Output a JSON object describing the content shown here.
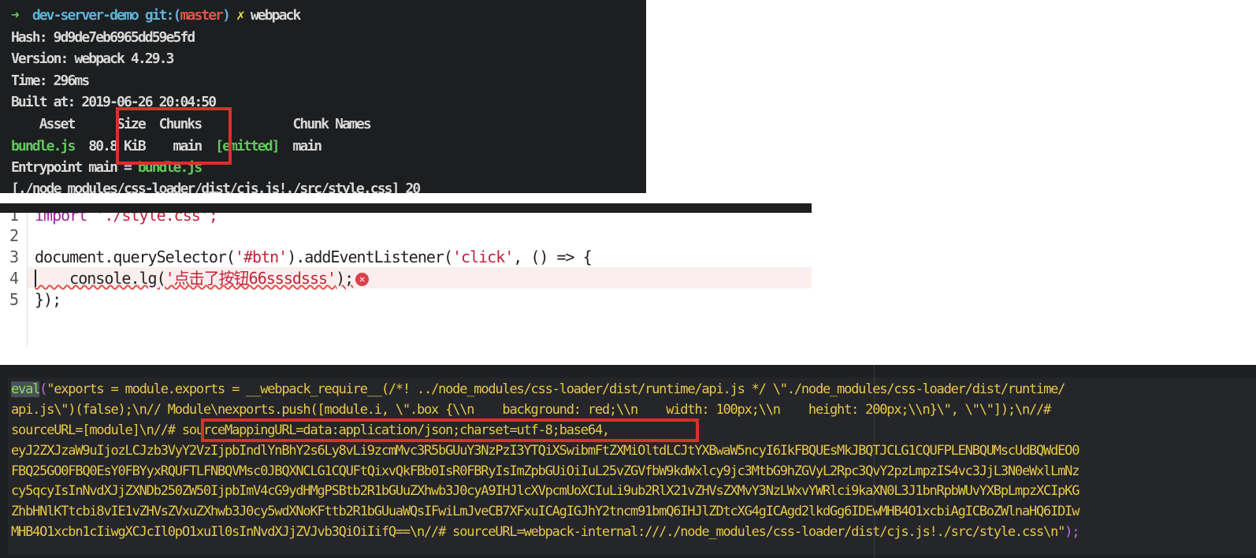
{
  "terminal": {
    "prompt_arrow": "➜",
    "dir": "dev-server-demo",
    "git_label": "git:(",
    "branch": "master",
    "git_close": ")",
    "dirty_mark": "✗",
    "command": "webpack",
    "hash": "Hash: 9d9de7eb6965dd59e5fd",
    "version": "Version: webpack 4.29.3",
    "time": "Time: 296ms",
    "built_at": "Built at: 2019-06-26 20:04:50",
    "table_header": "    Asset      Size  Chunks             Chunk Names",
    "asset_name": "bundle.js",
    "asset_size": "  80.8 KiB",
    "asset_chunks": "    main  ",
    "asset_status": "[emitted]",
    "asset_chunk_name": "  main",
    "entrypoint_label": "Entrypoint main = ",
    "entrypoint_file": "bundle.js",
    "module_line": "[./node_modules/css-loader/dist/cjs.js!./src/style.css] 20"
  },
  "editor": {
    "lines": [
      {
        "num": "1",
        "kw": "import",
        "rest": " './style.css';"
      },
      {
        "num": "2"
      },
      {
        "num": "3",
        "a": "document.querySelector(",
        "s1": "'#btn'",
        "b": ").addEventListener(",
        "s2": "'click'",
        "c": ", () => {"
      },
      {
        "num": "4",
        "a": "    console.lg(",
        "s1": "'点击了按钮66sssdsss'",
        "b": ");"
      },
      {
        "num": "5",
        "a": "});"
      }
    ],
    "error_icon": "✕"
  },
  "bundle": {
    "eval_kw": "eval",
    "lines": [
      "\"exports = module.exports = __webpack_require__(/*! ../node_modules/css-loader/dist/runtime/api.js */ \\\"./node_modules/css-loader/dist/runtime/",
      "api.js\\\")(false);\\n// Module\\nexports.push([module.i, \\\".box {\\\\n    background: red;\\\\n    width: 100px;\\\\n    height: 200px;\\\\n}\\\", \\\"\\\"]);\\n//#",
      "sourceURL=[module]\\n//# ",
      "sourceMappingURL=data:application/json;charset=utf-8;base64,",
      "eyJ2ZXJzaW9uIjozLCJzb3VyY2VzIjpbIndlYnBhY2s6Ly8vLi9zcmMvc3R5bGUuY3NzPzI3YTQiXSwibmFtZXMiOltdLCJtYXBwaW5ncyI6IkFBQUEsMkJBQTJCLG1CQUFPLENBQUMscUdBQWdEO0",
      "FBQ25GO0FBQ0EsY0FBYyxRQUFTLFNBQVMsc0JBQXNCLG1CQUFtQixvQkFBb0IsR0FBRyIsImZpbGUiOiIuL25vZGVfbW9kdWxlcy9jc3MtbG9hZGVyL2Rpc3QvY2pzLmpzIS4vc3JjL3N0eWxlLmNz",
      "cy5qcyIsInNvdXJjZXNDb250ZW50IjpbImV4cG9ydHMgPSBtb2R1bGUuZXhwb3J0cyA9IHJlcXVpcmUoXCIuLi9ub2RlX21vZHVsZXMvY3NzLWxvYWRlci9kaXN0L3J1bnRpbWUvYXBpLmpzXCIpKG",
      "ZhbHNlKTtcbi8vIE1vZHVsZVxuZXhwb3J0cy5wdXNoKFttb2R1bGUuaWQsIFwiLmJveCB7XFxuICAgIGJhY2tncm91bmQ6IHJlZDtcXG4gICAgd2lkdGg6IDEwMHB4O1xcbiAgICBoZWlnaHQ6IDIw",
      "MHB4O1xcbn1cIiwgXCJcIl0pO1xuIl0sInNvdXJjZVJvb3QiOiIifQ==\\n//# sourceURL=webpack-internal:///./node_modules/css-loader/dist/cjs.js!./src/style.css\\n\"",
      ");"
    ]
  }
}
